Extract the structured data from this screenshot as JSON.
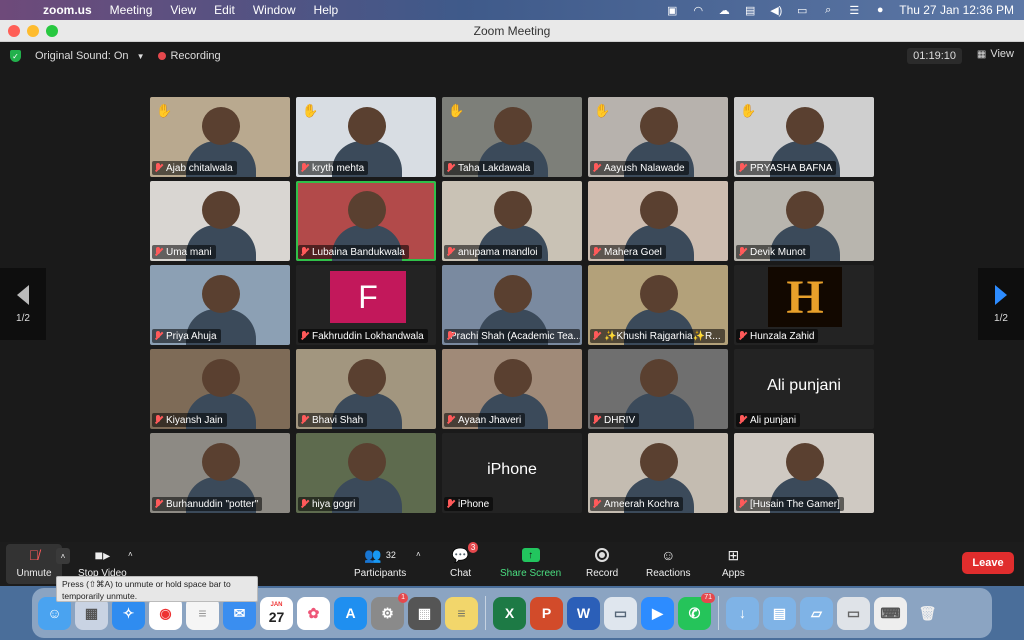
{
  "menubar": {
    "app_name": "zoom.us",
    "items": [
      "Meeting",
      "View",
      "Edit",
      "Window",
      "Help"
    ],
    "clock": "Thu 27 Jan  12:36 PM"
  },
  "window": {
    "title": "Zoom Meeting"
  },
  "topbar": {
    "original_sound": "Original Sound: On",
    "recording": "Recording",
    "timer": "01:19:10",
    "view": "View"
  },
  "pagination": {
    "page": "1/2"
  },
  "participants": [
    {
      "name": "Ajab chitalwala",
      "hand": true,
      "bg": "#b9a98f"
    },
    {
      "name": "kryth mehta",
      "hand": true,
      "bg": "#d8dde3"
    },
    {
      "name": "Taha Lakdawala",
      "hand": true,
      "bg": "#7d7f79"
    },
    {
      "name": "Aayush Nalawade",
      "hand": true,
      "bg": "#b7b2ad"
    },
    {
      "name": "PRYASHA  BAFNA",
      "hand": true,
      "bg": "#cfcfcf"
    },
    {
      "name": "Uma mani",
      "bg": "#d9d6d2"
    },
    {
      "name": "Lubaina Bandukwala",
      "bg": "#b24a4a",
      "active": true
    },
    {
      "name": "anupama mandloi",
      "bg": "#c9c2b5"
    },
    {
      "name": "Mahera Goel",
      "bg": "#cdbdb0"
    },
    {
      "name": "Devik Munot",
      "bg": "#b8b5ae"
    },
    {
      "name": "Priya Ahuja",
      "bg": "#8ca0b4"
    },
    {
      "name": "Fakhruddin Lokhandwala",
      "letter": "F",
      "bg": "#232323"
    },
    {
      "name": "Prachi Shah (Academic Tea...",
      "bg": "#7a8aa0"
    },
    {
      "name": "✨Khushi Rajgarhia✨R...",
      "bg": "#b3a17a"
    },
    {
      "name": "Hunzala Zahid",
      "logo": "H",
      "bg": "#232323"
    },
    {
      "name": "Kiyansh Jain",
      "bg": "#7e6b57"
    },
    {
      "name": "Bhavi Shah",
      "bg": "#a2967f"
    },
    {
      "name": "Ayaan Jhaveri",
      "bg": "#a08a78"
    },
    {
      "name": "DHRIV",
      "bg": "#6f6f6f"
    },
    {
      "name": "Ali punjani",
      "text": "Ali punjani",
      "bg": "#232323"
    },
    {
      "name": "Burhanuddin \"potter\"",
      "bg": "#8d8a84"
    },
    {
      "name": "hiya gogri",
      "bg": "#5e6b4e"
    },
    {
      "name": "iPhone",
      "text": "iPhone",
      "bg": "#232323"
    },
    {
      "name": "Ameerah Kochra",
      "bg": "#c4bcb1"
    },
    {
      "name": "[Husain The Gamer]",
      "bg": "#cfc9c2"
    }
  ],
  "toolbar": {
    "unmute": "Unmute",
    "stop_video": "Stop Video",
    "participants": "Participants",
    "participants_count": "32",
    "chat": "Chat",
    "chat_badge": "3",
    "share": "Share Screen",
    "record": "Record",
    "reactions": "Reactions",
    "apps": "Apps",
    "leave": "Leave"
  },
  "tooltip": {
    "text": "Press  (⇧⌘A) to unmute or hold space bar to temporarily unmute."
  },
  "dock": {
    "calendar_month": "JAN",
    "calendar_day": "27",
    "settings_badge": "1",
    "whatsapp_badge": "71",
    "apps": [
      "finder",
      "launchpad",
      "safari",
      "chrome",
      "notes",
      "mail",
      "calendar",
      "photos",
      "app-store",
      "system-preferences",
      "calculator",
      "stickies",
      "excel",
      "powerpoint",
      "word",
      "preview",
      "zoom",
      "whatsapp",
      "downloads",
      "documents",
      "applications",
      "screenshots",
      "keyboard",
      "trash"
    ]
  },
  "colors": {
    "active_speaker": "#30c04a",
    "leave": "#e02d2d",
    "share": "#22c55e",
    "badge": "#e5484d"
  }
}
